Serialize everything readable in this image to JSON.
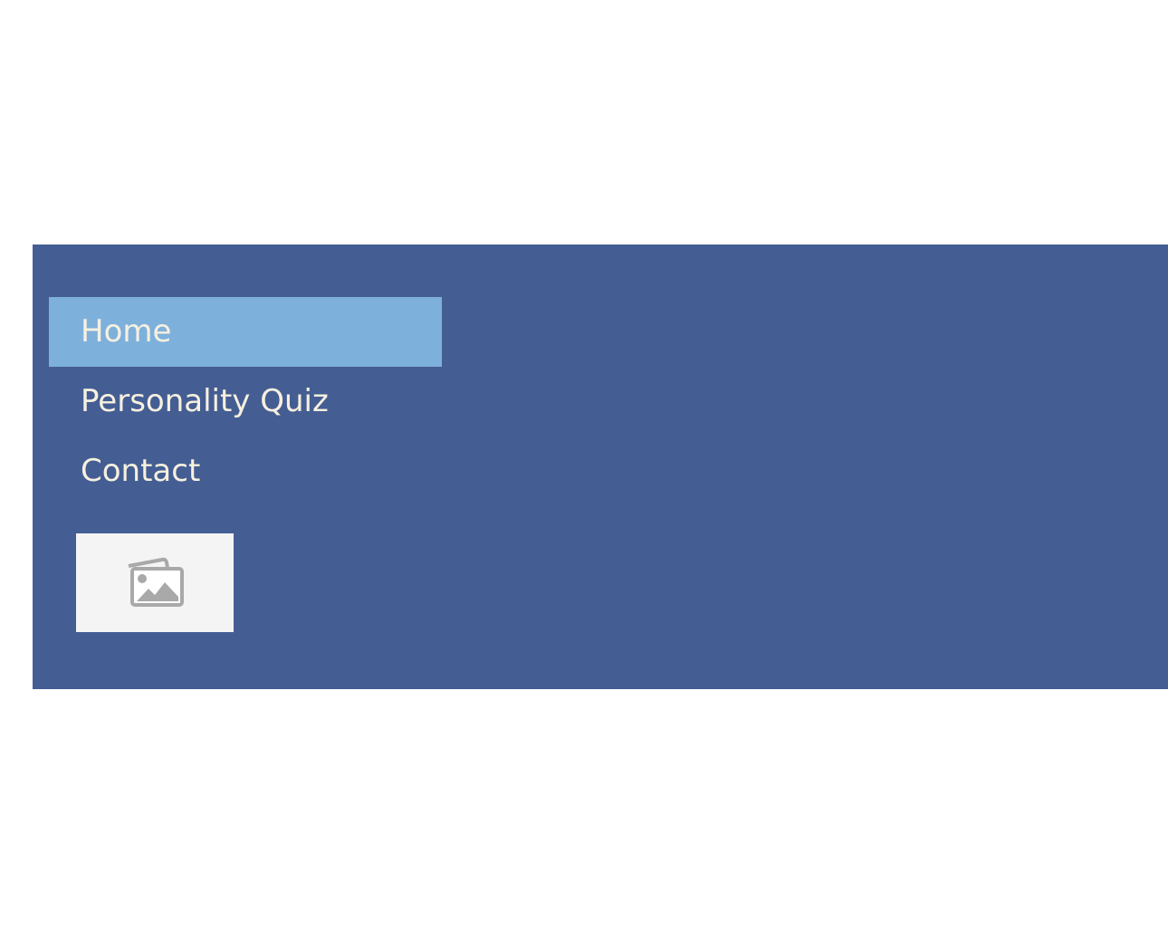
{
  "navigation": {
    "items": [
      {
        "label": "Home",
        "state": "active"
      },
      {
        "label": "Personality Quiz",
        "state": "default"
      },
      {
        "label": "Contact",
        "state": "default"
      }
    ]
  },
  "image": {
    "icon": "image-placeholder-icon"
  },
  "colors": {
    "panel_background": "#445e93",
    "active_item_background": "#7eb0dc",
    "nav_text": "#f6f0df",
    "image_background": "#f4f4f4",
    "icon_gray": "#a9a9a9"
  }
}
